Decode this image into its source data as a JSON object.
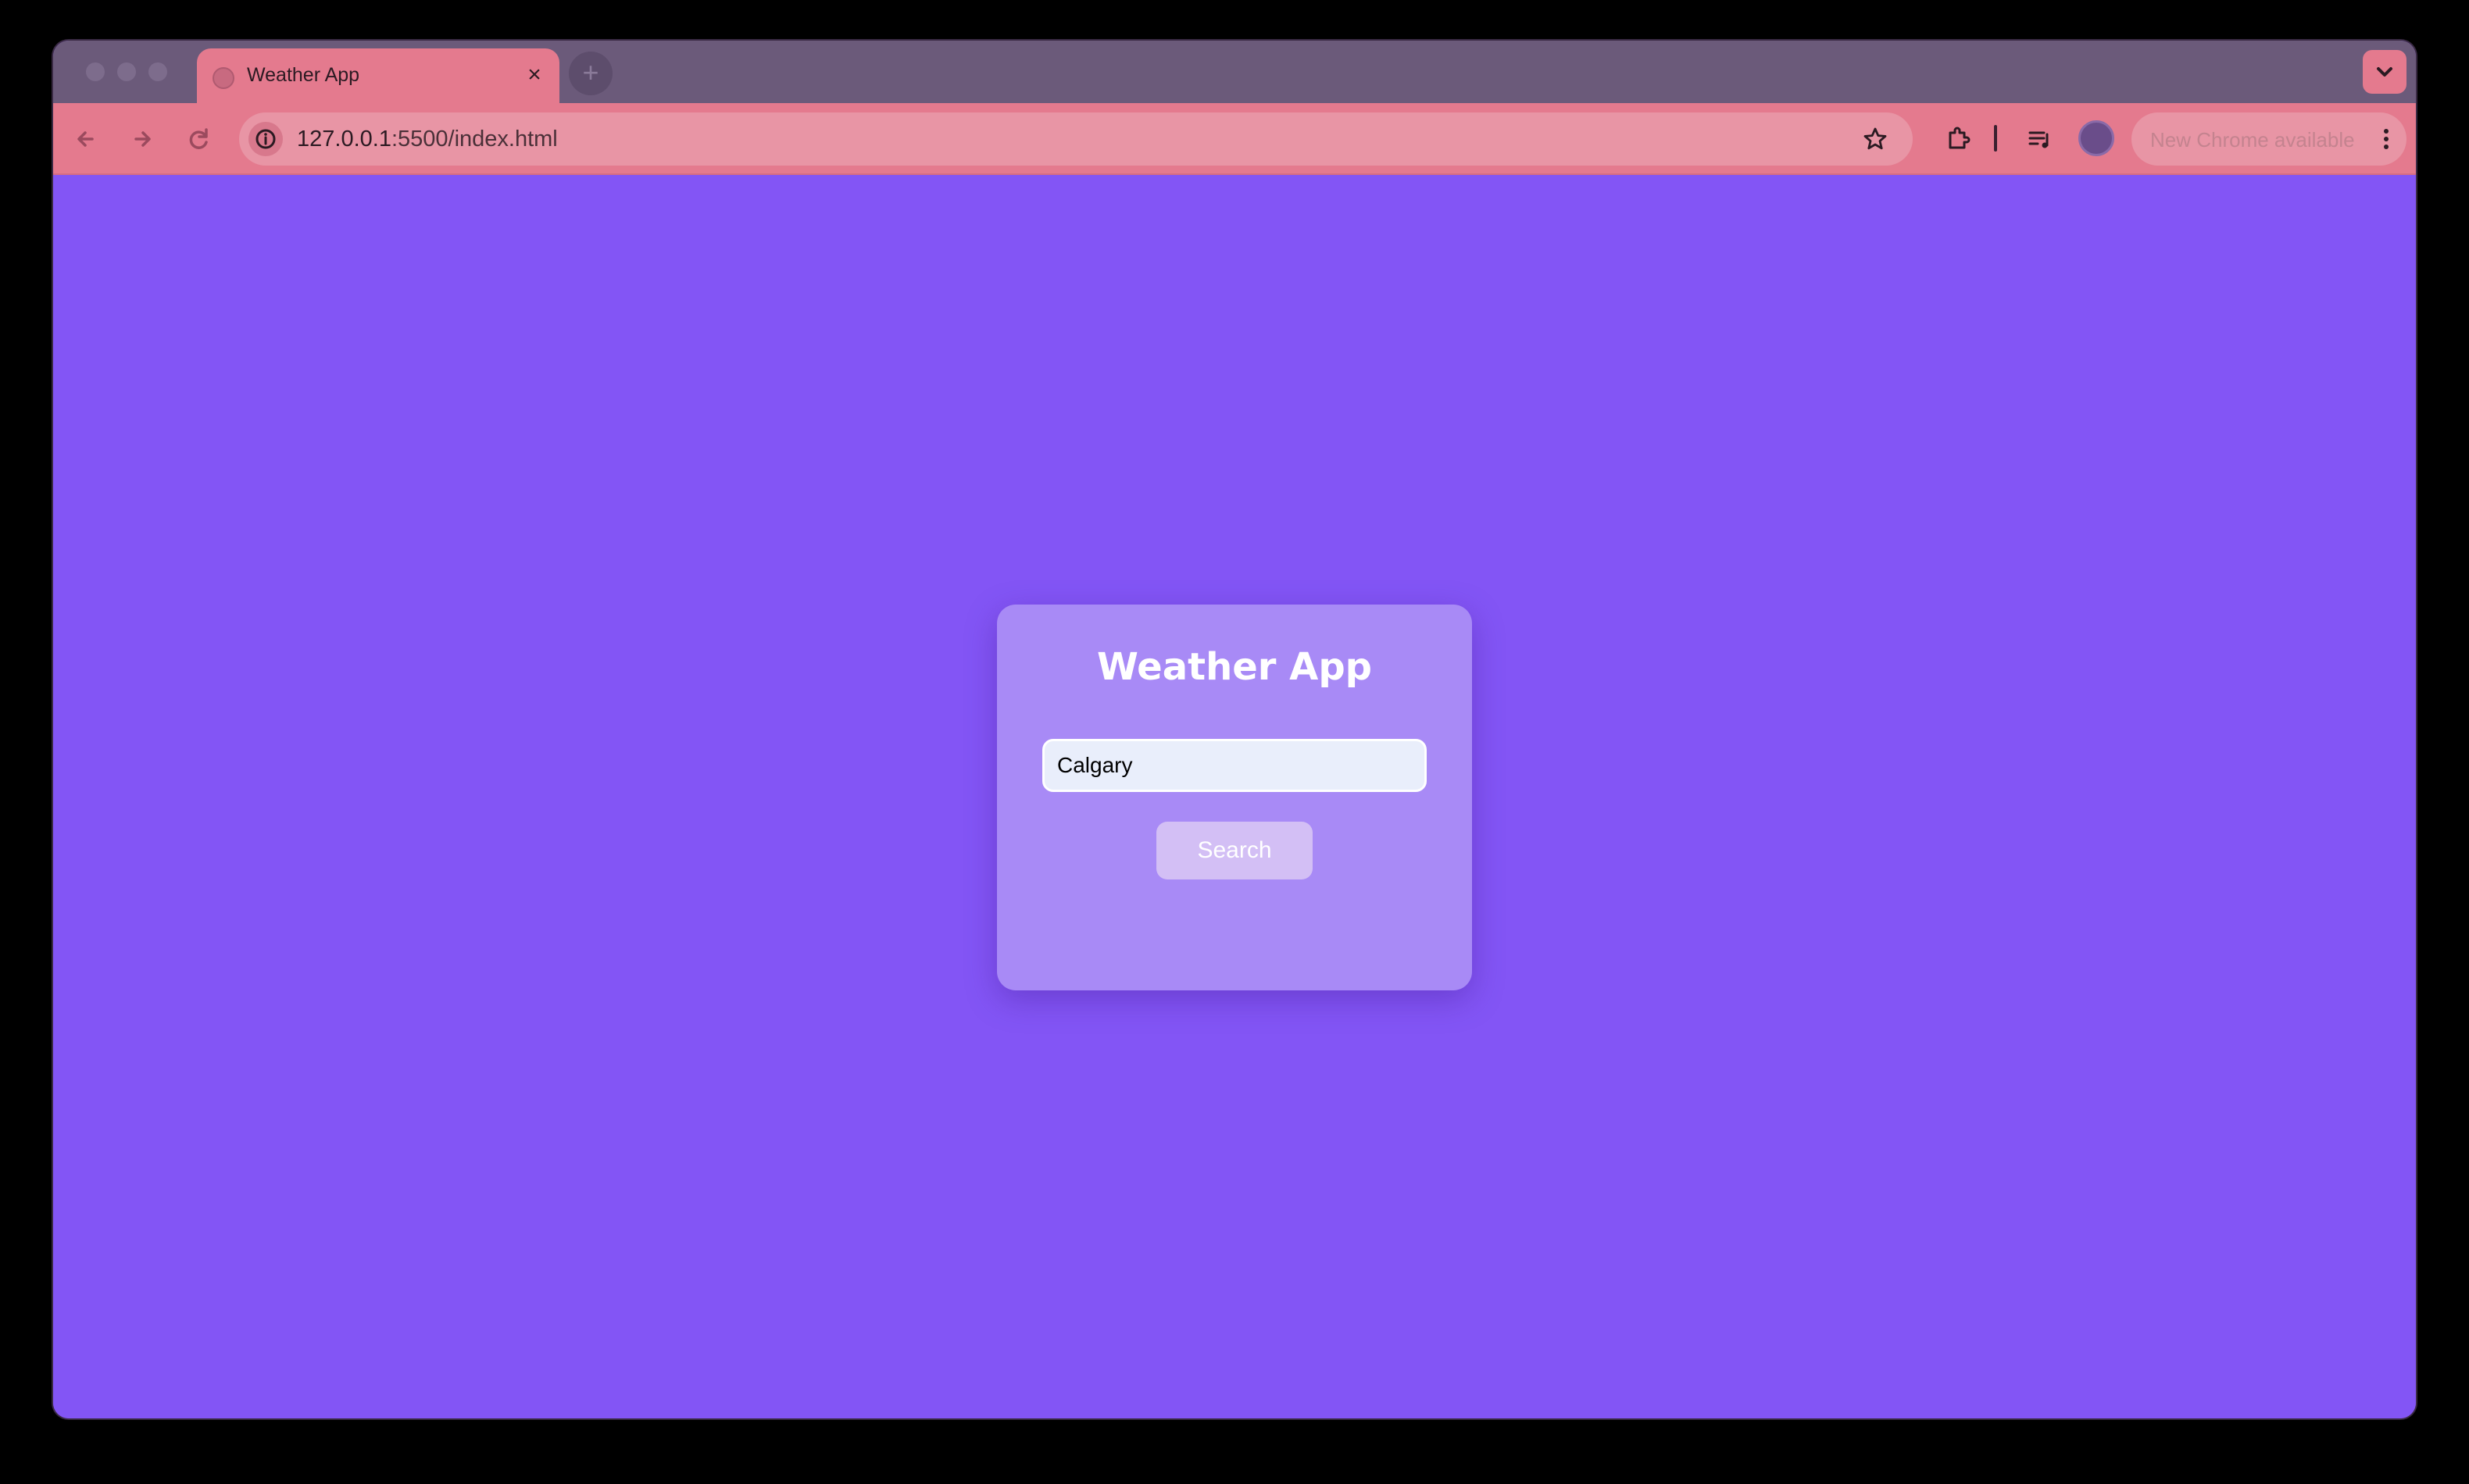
{
  "browser": {
    "tab": {
      "title": "Weather App",
      "close_glyph": "×",
      "favicon_icon": "globe-icon"
    },
    "new_tab_glyph": "+",
    "address_bar": {
      "host": "127.0.0.1",
      "path": ":5500/index.html",
      "site_info_icon": "info-icon",
      "bookmark_icon": "star-icon"
    },
    "toolbar_icons": [
      "back-arrow-icon",
      "forward-arrow-icon",
      "reload-icon",
      "extensions-puzzle-icon",
      "media-queue-icon",
      "profile-avatar-icon",
      "kebab-menu-icon"
    ],
    "update_chip": {
      "label": "New Chrome available"
    },
    "colors": {
      "tab_strip": "#6b5a7a",
      "toolbar": "#e47a8e",
      "omnibox": "#e895a5"
    }
  },
  "app": {
    "title": "Weather App",
    "city_input": {
      "value": "Calgary"
    },
    "search_button": {
      "label": "Search"
    },
    "colors": {
      "background": "#8355f5",
      "card": "#a88af6",
      "button": "#d3bff5",
      "input": "#e9eefb"
    }
  }
}
